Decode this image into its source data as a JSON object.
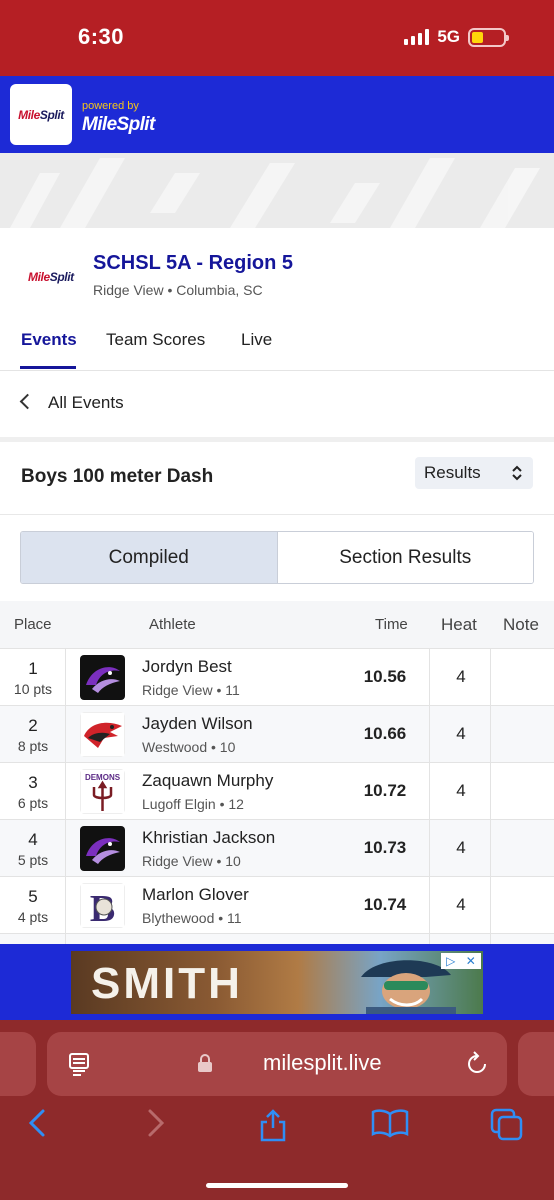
{
  "status_bar": {
    "time": "6:30",
    "network": "5G",
    "battery_level": 0.25
  },
  "brand": {
    "logo_text_red": "Mile",
    "logo_text_dark": "Split",
    "powered_by": "powered by",
    "powered_brand": "MileSplit"
  },
  "meet": {
    "title": "SCHSL 5A - Region 5",
    "subtitle": "Ridge View • Columbia, SC"
  },
  "tabs": [
    {
      "label": "Events",
      "active": true
    },
    {
      "label": "Team Scores",
      "active": false
    },
    {
      "label": "Live",
      "active": false
    }
  ],
  "back": {
    "label": "All Events"
  },
  "event": {
    "title": "Boys 100 meter Dash",
    "view_select": "Results"
  },
  "segmented": {
    "compiled": "Compiled",
    "section": "Section Results"
  },
  "table": {
    "headers": {
      "place": "Place",
      "athlete": "Athlete",
      "time": "Time",
      "heat": "Heat",
      "note": "Note"
    },
    "rows": [
      {
        "place": "1",
        "points": "10 pts",
        "name": "Jordyn Best",
        "school": "Ridge View • 11",
        "time": "10.56",
        "heat": "4",
        "logo": "ridge-view-panther"
      },
      {
        "place": "2",
        "points": "8 pts",
        "name": "Jayden Wilson",
        "school": "Westwood • 10",
        "time": "10.66",
        "heat": "4",
        "logo": "westwood-redhawk"
      },
      {
        "place": "3",
        "points": "6 pts",
        "name": "Zaquawn Murphy",
        "school": "Lugoff Elgin • 12",
        "time": "10.72",
        "heat": "4",
        "logo": "lugoff-elgin-demons",
        "logo_text": "DEMONS"
      },
      {
        "place": "4",
        "points": "5 pts",
        "name": "Khristian Jackson",
        "school": "Ridge View • 10",
        "time": "10.73",
        "heat": "4",
        "logo": "ridge-view-panther"
      },
      {
        "place": "5",
        "points": "4 pts",
        "name": "Marlon Glover",
        "school": "Blythewood • 11",
        "time": "10.74",
        "heat": "4",
        "logo": "blythewood-bengal",
        "logo_text": "B"
      }
    ]
  },
  "ad": {
    "brand": "SMITH"
  },
  "browser": {
    "url": "milesplit.live"
  },
  "colors": {
    "status_red": "#b51f24",
    "brand_blue": "#1d2ad6",
    "link_navy": "#15169a",
    "browser_maroon": "#8e2a2b"
  }
}
